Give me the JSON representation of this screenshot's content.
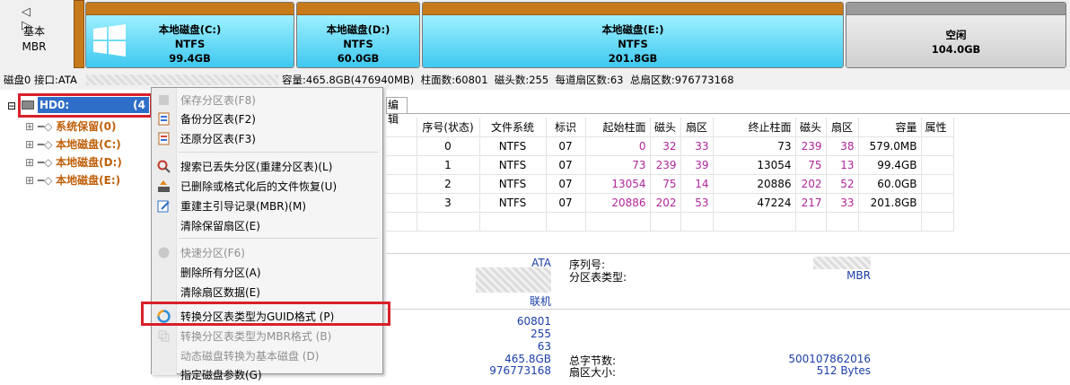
{
  "nav": {
    "arrows": "◁ ▷"
  },
  "disk_type": {
    "line1": "基本",
    "line2": "MBR"
  },
  "partitions": [
    {
      "name": "本地磁盘(C:)",
      "fs": "NTFS",
      "size": "99.4GB"
    },
    {
      "name": "本地磁盘(D:)",
      "fs": "NTFS",
      "size": "60.0GB"
    },
    {
      "name": "本地磁盘(E:)",
      "fs": "NTFS",
      "size": "201.8GB"
    },
    {
      "name": "空闲",
      "size": "104.0GB"
    }
  ],
  "infobar": {
    "left": "磁盘0 接口:ATA",
    "right": "容量:465.8GB(476940MB)  柱面数:60801  磁头数:255  每道扇区数:63  总扇区数:976773168"
  },
  "tree": {
    "root_label": "HD0:",
    "root_suffix": "(4",
    "items": [
      "系统保留(0)",
      "本地磁盘(C:)",
      "本地磁盘(D:)",
      "本地磁盘(E:)"
    ]
  },
  "tab_partial": "编辑",
  "table": {
    "headers": [
      "序号(状态)",
      "文件系统",
      "标识",
      "起始柱面",
      "磁头",
      "扇区",
      "终止柱面",
      "磁头",
      "扇区",
      "容量",
      "属性"
    ],
    "rows": [
      [
        "0",
        "NTFS",
        "07",
        "0",
        "32",
        "33",
        "73",
        "239",
        "38",
        "579.0MB",
        ""
      ],
      [
        "1",
        "NTFS",
        "07",
        "73",
        "239",
        "39",
        "13054",
        "75",
        "13",
        "99.4GB",
        ""
      ],
      [
        "2",
        "NTFS",
        "07",
        "13054",
        "75",
        "14",
        "20886",
        "202",
        "52",
        "60.0GB",
        ""
      ],
      [
        "3",
        "NTFS",
        "07",
        "20886",
        "202",
        "53",
        "47224",
        "217",
        "33",
        "201.8GB",
        ""
      ]
    ]
  },
  "details": {
    "interface_value": "ATA",
    "serial_label": "序列号:",
    "pt_type_label": "分区表类型:",
    "pt_type_value": "MBR",
    "status_value": "联机",
    "cylinders": "60801",
    "heads": "255",
    "sectors": "63",
    "capacity": "465.8GB",
    "total_bytes_label": "总字节数:",
    "total_bytes_value": "500107862016",
    "total_sectors": "976773168",
    "sector_size_label": "扇区大小:",
    "sector_size_value": "512 Bytes"
  },
  "menu": {
    "items": [
      {
        "label": "保存分区表(F8)",
        "disabled": true
      },
      {
        "label": "备份分区表(F2)",
        "disabled": false
      },
      {
        "label": "还原分区表(F3)",
        "disabled": false
      },
      {
        "label": "搜索已丢失分区(重建分区表)(L)",
        "disabled": false
      },
      {
        "label": "已删除或格式化后的文件恢复(U)",
        "disabled": false
      },
      {
        "label": "重建主引导记录(MBR)(M)",
        "disabled": false
      },
      {
        "label": "清除保留扇区(E)",
        "disabled": false
      },
      {
        "label": "快速分区(F6)",
        "disabled": true
      },
      {
        "label": "删除所有分区(A)",
        "disabled": false
      },
      {
        "label": "清除扇区数据(E)",
        "disabled": false
      },
      {
        "label": "转换分区表类型为GUID格式 (P)",
        "disabled": false
      },
      {
        "label": "转换分区表类型为MBR格式 (B)",
        "disabled": true
      },
      {
        "label": "动态磁盘转换为基本磁盘 (D)",
        "disabled": true
      },
      {
        "label": "指定磁盘参数(G)",
        "disabled": false
      }
    ]
  },
  "colors": {
    "accent_red": "#d9202a",
    "partition_cap": "#c77a1a",
    "partition_fill": "#3fc8f0",
    "number_purple": "#b0269a",
    "value_blue": "#1a3ea8"
  }
}
